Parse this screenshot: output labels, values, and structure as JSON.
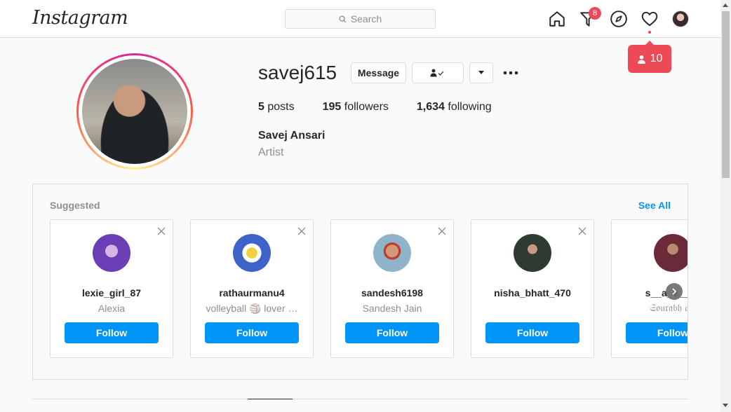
{
  "nav": {
    "logo": "Instagram",
    "search_placeholder": "Search",
    "direct_badge": "8",
    "activity_tooltip_count": "10"
  },
  "profile": {
    "username": "savej615",
    "message_label": "Message",
    "posts_count": "5",
    "posts_label": "posts",
    "followers_count": "195",
    "followers_label": "followers",
    "following_count": "1,634",
    "following_label": "following",
    "full_name": "Savej Ansari",
    "category": "Artist"
  },
  "suggested": {
    "title": "Suggested",
    "see_all": "See All",
    "cards": [
      {
        "username": "lexie_girl_87",
        "subtitle": "Alexia",
        "follow": "Follow",
        "color": "#6a3fb5"
      },
      {
        "username": "rathaurmanu4",
        "subtitle": "volleyball 🏐 lover …",
        "follow": "Follow",
        "color": "#3d63c9"
      },
      {
        "username": "sandesh6198",
        "subtitle": "Sandesh Jain",
        "follow": "Follow",
        "color": "#8fb3c8"
      },
      {
        "username": "nisha_bhatt_470",
        "subtitle": "",
        "follow": "Follow",
        "color": "#2f3a33"
      },
      {
        "username": "s__a_v___o",
        "subtitle": "𝔖𝔬𝔲𝔯𝔞𝔟𝔥 𝔠𝔥𝔢",
        "follow": "Follow",
        "color": "#6b2a3a"
      }
    ]
  },
  "colors": {
    "accent": "#0095f6",
    "notification": "#ed4956"
  }
}
